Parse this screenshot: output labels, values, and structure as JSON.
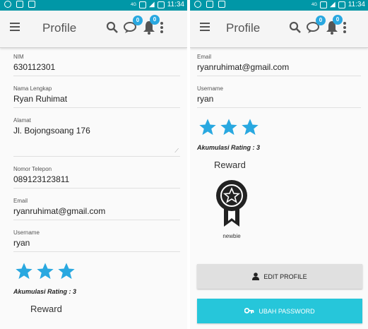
{
  "status_bar": {
    "time": "11:34",
    "network": "4G"
  },
  "app_bar": {
    "title": "Profile",
    "chat_badge": "0",
    "notif_badge": "0"
  },
  "profile": {
    "nim_label": "NIM",
    "nim_value": "630112301",
    "name_label": "Nama Lengkap",
    "name_value": "Ryan Ruhimat",
    "address_label": "Alamat",
    "address_value": "Jl. Bojongsoang 176",
    "phone_label": "Nomor Telepon",
    "phone_value": "089123123811",
    "email_label": "Email",
    "email_value": "ryanruhimat@gmail.com",
    "username_label": "Username",
    "username_value": "ryan"
  },
  "rating": {
    "stars": 3,
    "label": "Akumulasi Rating : 3"
  },
  "reward": {
    "title": "Reward",
    "badge_label": "newbie"
  },
  "buttons": {
    "edit_profile": "EDIT PROFILE",
    "change_password": "UBAH PASSWORD"
  },
  "colors": {
    "status_bar": "#0097a7",
    "star": "#29a8e0",
    "badge": "#29a8e0",
    "primary_button": "#26c6da"
  }
}
